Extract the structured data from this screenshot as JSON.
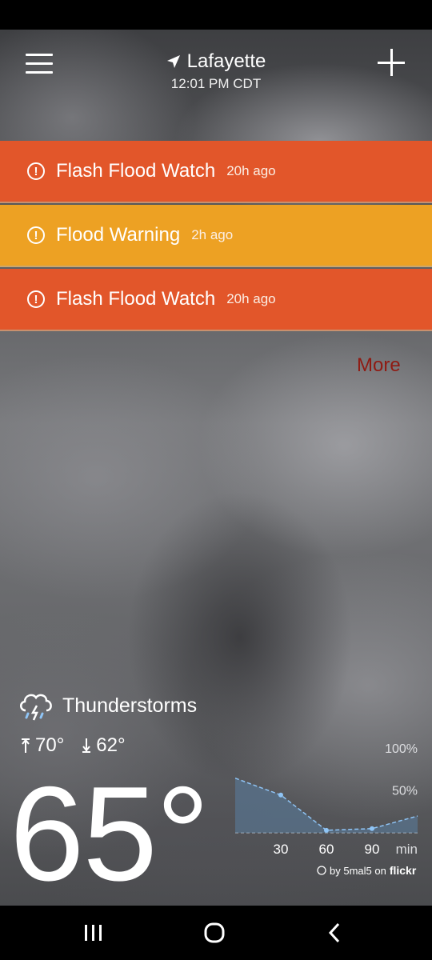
{
  "header": {
    "location": "Lafayette",
    "time": "12:01 PM CDT"
  },
  "alerts": [
    {
      "title": "Flash Flood Watch",
      "ago": "20h ago",
      "color": "#e2562a"
    },
    {
      "title": "Flood Warning",
      "ago": "2h ago",
      "color": "#eda123"
    },
    {
      "title": "Flash Flood Watch",
      "ago": "20h ago",
      "color": "#e2562a"
    }
  ],
  "more_label": "More",
  "current": {
    "condition": "Thunderstorms",
    "high": "70°",
    "low": "62°",
    "temperature": "65°",
    "icon": "thunderstorm-icon"
  },
  "chart_data": {
    "type": "area",
    "title": "",
    "y_ticks": [
      "100%",
      "50%"
    ],
    "x_ticks": [
      "30",
      "60",
      "90"
    ],
    "x_unit": "min",
    "x": [
      0,
      30,
      60,
      90,
      120
    ],
    "y": [
      65,
      45,
      3,
      5,
      20
    ],
    "ylim": [
      0,
      100
    ],
    "xlim": [
      0,
      120
    ]
  },
  "credit": {
    "prefix": "by 5mal5 on",
    "brand": "flickr"
  },
  "colors": {
    "alert_orange": "#e2562a",
    "alert_yellow": "#eda123",
    "more_text": "#8f1a12",
    "chart_line": "#8fc4f5"
  }
}
